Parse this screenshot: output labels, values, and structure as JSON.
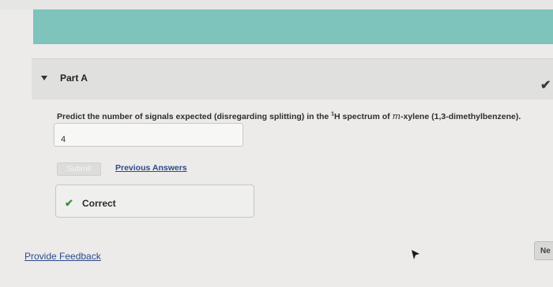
{
  "part": {
    "title": "Part A",
    "status_icon": "check-icon"
  },
  "question": {
    "text_before": "Predict the number of signals expected (disregarding splitting) in the ",
    "superscript": "1",
    "text_mid": "H spectrum of ",
    "math_var": "m",
    "text_after": "-xylene (1,3-dimethylbenzene)."
  },
  "answer": {
    "value": "4"
  },
  "actions": {
    "submit_label": "Submit",
    "previous_answers_label": "Previous Answers"
  },
  "feedback": {
    "status_icon": "check-icon",
    "status_label": "Correct",
    "status_color": "#3f8f3a"
  },
  "footer": {
    "provide_feedback_label": "Provide Feedback",
    "next_label": "Ne"
  },
  "colors": {
    "banner": "#7fc3bd",
    "link": "#2b4a8a"
  }
}
